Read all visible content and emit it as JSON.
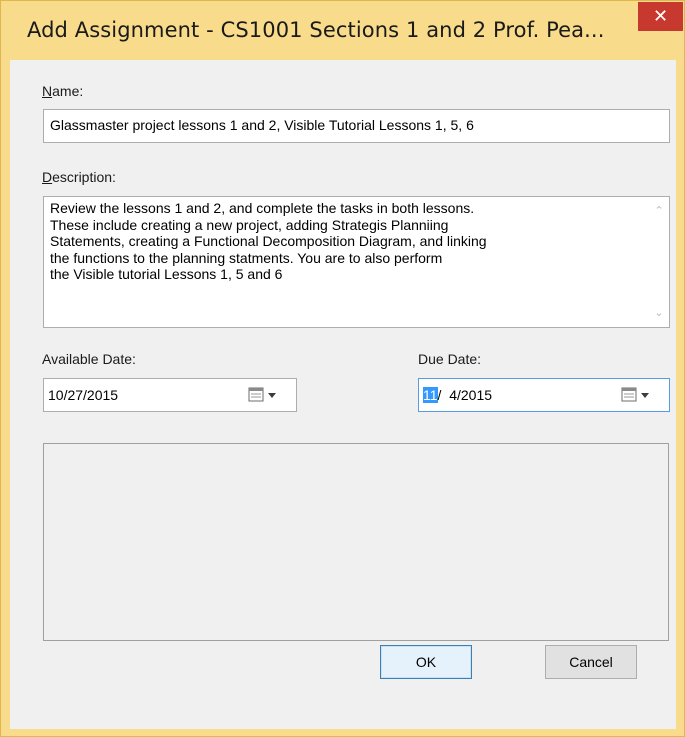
{
  "window": {
    "title": "Add Assignment - CS1001 Sections 1 and 2 Prof. Pea...",
    "close_glyph": "✕",
    "accent_color": "#f8dc8c",
    "close_color": "#c7392f"
  },
  "name": {
    "label_mnemonic": "N",
    "label_rest": "ame:",
    "value": "Glassmaster project lessons 1 and 2, Visible Tutorial Lessons 1, 5, 6"
  },
  "description": {
    "label_mnemonic": "D",
    "label_rest": "escription:",
    "value": "Review the lessons 1 and 2, and complete the tasks in both lessons.\nThese include creating a new project, adding Strategis Planniing\nStatements, creating a Functional Decomposition Diagram, and linking\nthe functions to the planning statments. You are to also perform\nthe Visible tutorial Lessons 1, 5 and 6",
    "scroll_up_glyph": "⌃",
    "scroll_down_glyph": "⌄"
  },
  "available_date": {
    "label": "Available Date:",
    "value": "10/27/2015",
    "icon": "calendar-dropdown-icon"
  },
  "due_date": {
    "label": "Due Date:",
    "month_selected": "11",
    "rest": "/  4/2015",
    "icon": "calendar-dropdown-icon"
  },
  "buttons": {
    "ok": "OK",
    "cancel": "Cancel"
  }
}
